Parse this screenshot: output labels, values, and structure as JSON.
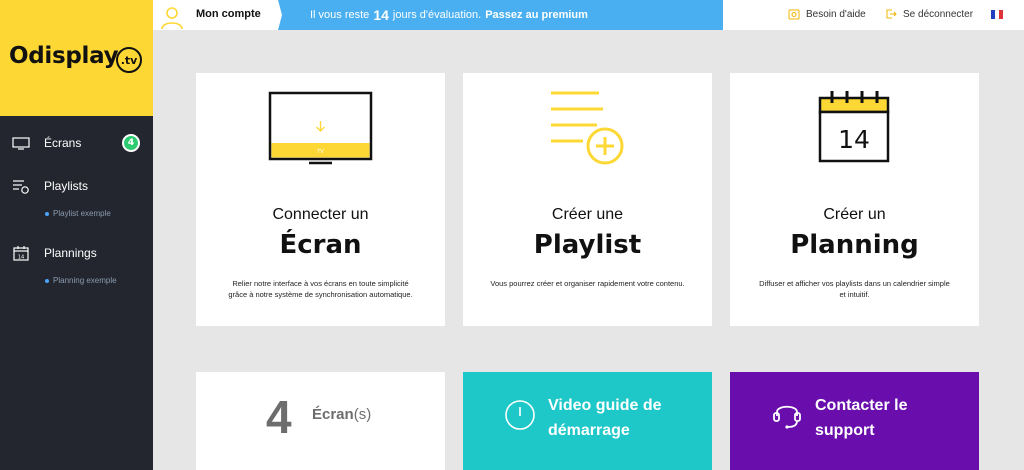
{
  "brand": {
    "name": "Odisplay",
    "badge": ".tv",
    "color": "#fdd835"
  },
  "sidebar": {
    "items": [
      {
        "label": "Écrans",
        "icon": "monitor-icon",
        "count": "4"
      },
      {
        "label": "Playlists",
        "icon": "playlist-icon",
        "sub": "Playlist exemple"
      },
      {
        "label": "Plannings",
        "icon": "calendar-icon",
        "sub": "Planning exemple"
      }
    ]
  },
  "topbar": {
    "account_label": "Mon compte",
    "trial_prefix": "Il vous reste",
    "trial_days": "14",
    "trial_suffix": "jours d'évaluation.",
    "trial_cta": "Passez au premium",
    "help_label": "Besoin d'aide",
    "logout_label": "Se déconnecter",
    "language": "fr"
  },
  "cards": [
    {
      "small_title": "Connecter un",
      "big_title": "Écran",
      "desc": "Relier notre interface à vos écrans en toute simplicité grâce à notre système de synchronisation automatique.",
      "screen_label": "TV",
      "icon": "tv-icon"
    },
    {
      "small_title": "Créer une",
      "big_title": "Playlist",
      "desc": "Vous pourrez créer et organiser rapidement votre contenu.",
      "icon": "add-playlist-icon"
    },
    {
      "small_title": "Créer un",
      "big_title": "Planning",
      "desc": "Diffuser et afficher vos playlists dans un calendrier simple et intuitif.",
      "calendar_day": "14",
      "icon": "calendar-14-icon"
    }
  ],
  "bottom": {
    "count_num": "4",
    "count_label": "Écran",
    "count_suffix": "(s)",
    "video_label": "Video guide de\ndémarrage",
    "video_color": "#1ec8c8",
    "support_label": "Contacter le\nsupport",
    "support_color": "#6a0dad"
  },
  "colors": {
    "sidebar_bg": "#23262e",
    "accent_yellow": "#fdd835",
    "trial_blue": "#4aaff0",
    "badge_green": "#2ecc71"
  }
}
